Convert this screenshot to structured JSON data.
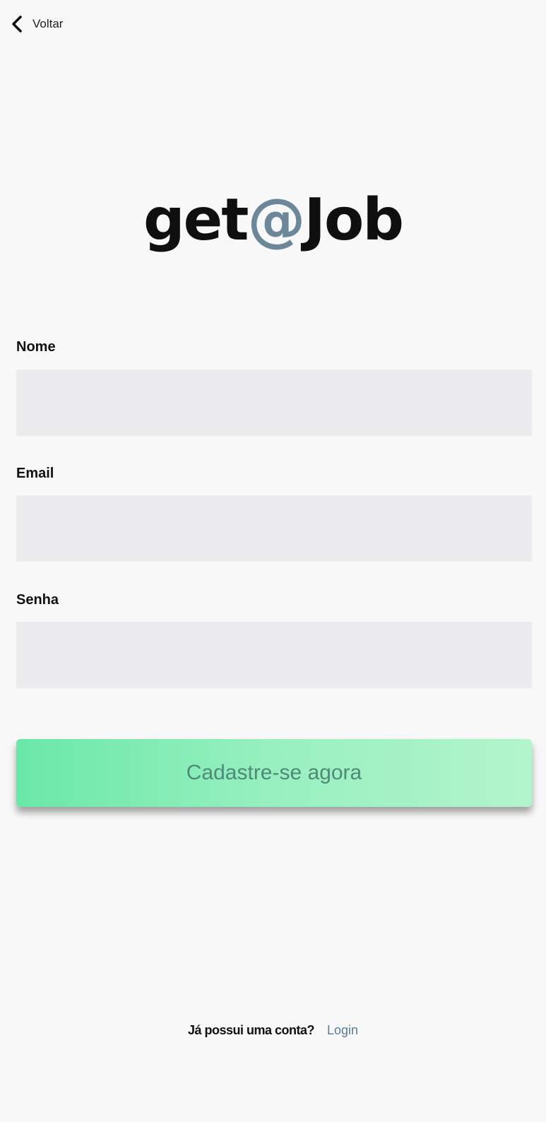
{
  "header": {
    "back_label": "Voltar",
    "back_icon": "chevron-left-icon"
  },
  "logo": {
    "part1": "get",
    "at": "@",
    "part2": "Job",
    "accent_color": "#6b8799"
  },
  "form": {
    "name_label": "Nome",
    "name_value": "",
    "email_label": "Email",
    "email_value": "",
    "password_label": "Senha",
    "password_value": "",
    "submit_label": "Cadastre-se agora",
    "submit_gradient": [
      "#6ae8a8",
      "#b3f4cd"
    ]
  },
  "footer": {
    "question": "Já possui uma conta?",
    "login_label": "Login",
    "link_color": "#5a7d92"
  }
}
